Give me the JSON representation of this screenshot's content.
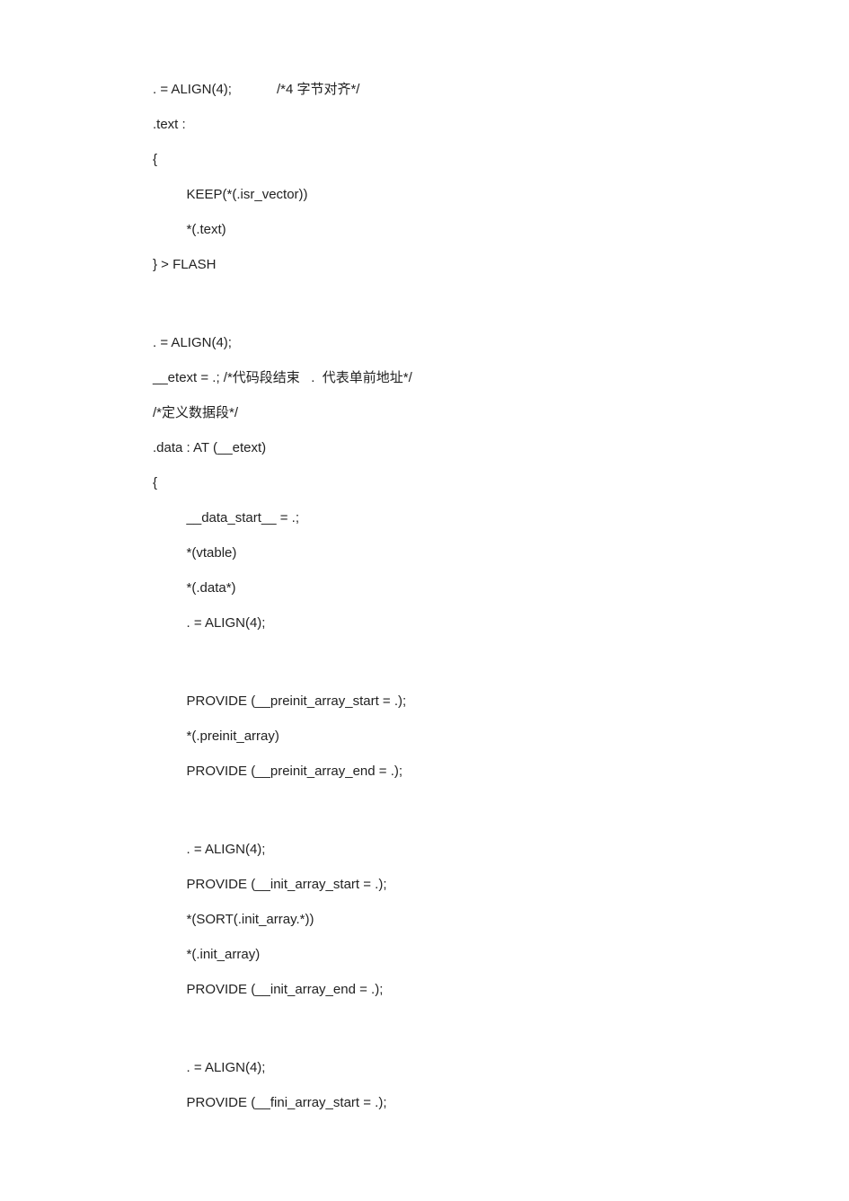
{
  "lines": {
    "l1": ". = ALIGN(4);            /*4 字节对齐*/",
    "l2": ".text :",
    "l3": "{",
    "l4": "         KEEP(*(.isr_vector))",
    "l5": "         *(.text)",
    "l6": "} > FLASH",
    "l7": ". = ALIGN(4);",
    "l8": "__etext = .; /*代码段结束   .  代表单前地址*/",
    "l9": "/*定义数据段*/",
    "l10": ".data : AT (__etext)",
    "l11": "{",
    "l12": "         __data_start__ = .;",
    "l13": "         *(vtable)",
    "l14": "         *(.data*)",
    "l15": "         . = ALIGN(4);",
    "l16": "         PROVIDE (__preinit_array_start = .);",
    "l17": "         *(.preinit_array)",
    "l18": "         PROVIDE (__preinit_array_end = .);",
    "l19": "         . = ALIGN(4);",
    "l20": "         PROVIDE (__init_array_start = .);",
    "l21": "         *(SORT(.init_array.*))",
    "l22": "         *(.init_array)",
    "l23": "         PROVIDE (__init_array_end = .);",
    "l24": "         . = ALIGN(4);",
    "l25": "         PROVIDE (__fini_array_start = .);"
  }
}
